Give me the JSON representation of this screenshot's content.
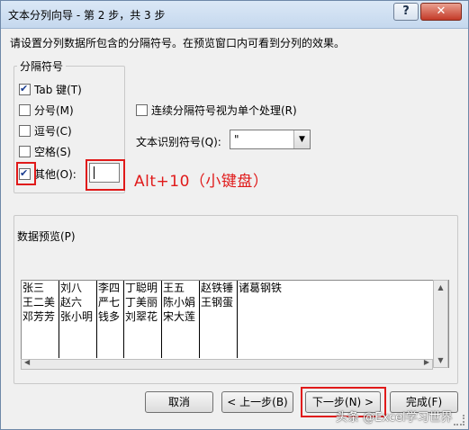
{
  "window": {
    "title": "文本分列向导 - 第 2 步，共 3 步",
    "help_glyph": "?",
    "close_glyph": "✕"
  },
  "instruction": "请设置分列数据所包含的分隔符号。在预览窗口内可看到分列的效果。",
  "delimiters": {
    "group_label": "分隔符号",
    "options": [
      {
        "label": "Tab 键(T)",
        "checked": true
      },
      {
        "label": "分号(M)",
        "checked": false
      },
      {
        "label": "逗号(C)",
        "checked": false
      },
      {
        "label": "空格(S)",
        "checked": false
      },
      {
        "label": "其他(O):",
        "checked": true
      }
    ],
    "other_value": ""
  },
  "annotation": {
    "hint": "Alt+10（小键盘）",
    "color": "#e01a1a"
  },
  "consecutive": {
    "label": "连续分隔符号视为单个处理(R)",
    "checked": false
  },
  "text_qualifier": {
    "label": "文本识别符号(Q):",
    "value": "\""
  },
  "preview": {
    "label": "数据预览(P)",
    "columns": [
      [
        "张三",
        "王二美",
        "邓芳芳"
      ],
      [
        "刘八",
        "赵六",
        "张小明"
      ],
      [
        "李四",
        "严七",
        "钱多"
      ],
      [
        "丁聪明",
        "丁美丽",
        "刘翠花"
      ],
      [
        "王五",
        "陈小娟",
        "宋大莲"
      ],
      [
        "赵铁锤",
        "王钢蛋"
      ],
      [
        "诸葛钢铁"
      ]
    ]
  },
  "buttons": {
    "cancel": "取消",
    "back": "< 上一步(B)",
    "next": "下一步(N) >",
    "finish": "完成(F)"
  },
  "watermark": "头条 @Excel学习世界"
}
